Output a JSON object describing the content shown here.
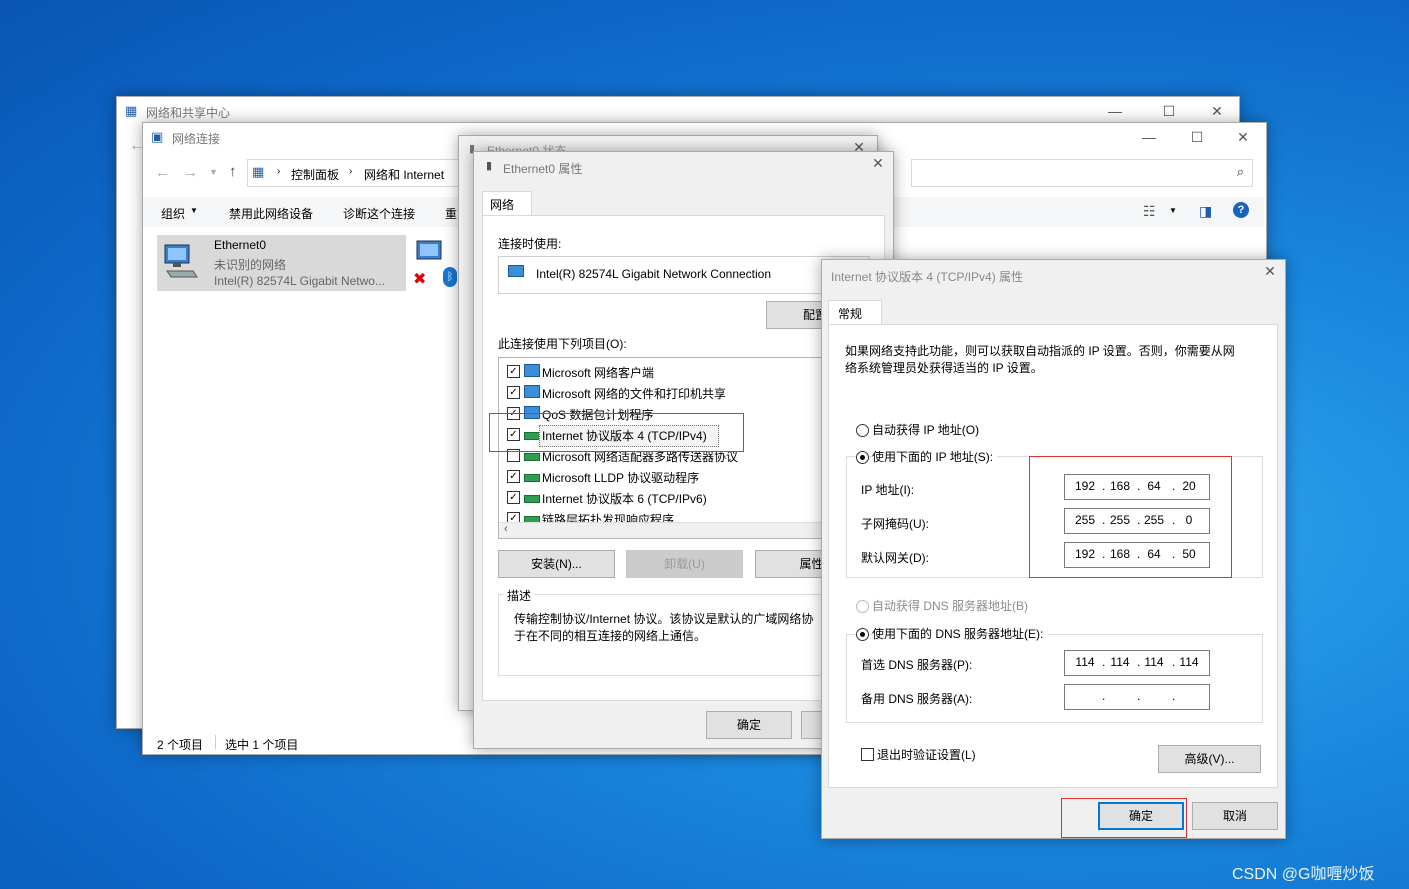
{
  "nsc_window": {
    "title": "网络和共享中心"
  },
  "nc_window": {
    "title": "网络连接",
    "breadcrumb": [
      "控制面板",
      "网络和 Internet"
    ],
    "toolbar": [
      "组织",
      "禁用此网络设备",
      "诊断这个连接",
      "重"
    ],
    "adapter": {
      "name": "Ethernet0",
      "status": "未识别的网络",
      "device": "Intel(R) 82574L Gigabit Netwo..."
    },
    "statusbar": {
      "count": "2 个项目",
      "selected": "选中 1 个项目"
    }
  },
  "status_window": {
    "title": "Ethernet0 状态"
  },
  "props_window": {
    "title": "Ethernet0 属性",
    "tab": "网络",
    "connect_using_label": "连接时使用:",
    "adapter_name": "Intel(R) 82574L Gigabit Network Connection",
    "configure_label": "配置(",
    "items_label": "此连接使用下列项目(O):",
    "items": [
      {
        "label": "Microsoft 网络客户端",
        "checked": true
      },
      {
        "label": "Microsoft 网络的文件和打印机共享",
        "checked": true
      },
      {
        "label": "QoS 数据包计划程序",
        "checked": true
      },
      {
        "label": "Internet 协议版本 4 (TCP/IPv4)",
        "checked": true
      },
      {
        "label": "Microsoft 网络适配器多路传送器协议",
        "checked": false
      },
      {
        "label": "Microsoft LLDP 协议驱动程序",
        "checked": true
      },
      {
        "label": "Internet 协议版本 6 (TCP/IPv6)",
        "checked": true
      },
      {
        "label": "链路层拓扑发现响应程序",
        "checked": true
      }
    ],
    "install_label": "安装(N)...",
    "uninstall_label": "卸载(U)",
    "properties_label": "属性(",
    "desc_title": "描述",
    "desc_text_1": "传输控制协议/Internet 协议。该协议是默认的广域网络协",
    "desc_text_2": "于在不同的相互连接的网络上通信。",
    "ok_label": "确定"
  },
  "ipv4_window": {
    "title": "Internet 协议版本 4 (TCP/IPv4) 属性",
    "tab": "常规",
    "intro_1": "如果网络支持此功能，则可以获取自动指派的 IP 设置。否则，你需要从网",
    "intro_2": "络系统管理员处获得适当的 IP 设置。",
    "auto_ip_label": "自动获得 IP 地址(O)",
    "manual_ip_label": "使用下面的 IP 地址(S):",
    "ip_label": "IP 地址(I):",
    "ip": [
      "192",
      "168",
      "64",
      "20"
    ],
    "mask_label": "子网掩码(U):",
    "mask": [
      "255",
      "255",
      "255",
      "0"
    ],
    "gateway_label": "默认网关(D):",
    "gateway": [
      "192",
      "168",
      "64",
      "50"
    ],
    "auto_dns_label": "自动获得 DNS 服务器地址(B)",
    "manual_dns_label": "使用下面的 DNS 服务器地址(E):",
    "dns1_label": "首选 DNS 服务器(P):",
    "dns1": [
      "114",
      "114",
      "114",
      "114"
    ],
    "dns2_label": "备用 DNS 服务器(A):",
    "dns2": [
      "",
      "",
      "",
      ""
    ],
    "validate_label": "退出时验证设置(L)",
    "advanced_label": "高级(V)...",
    "ok_label": "确定",
    "cancel_label": "取消"
  },
  "watermark": "CSDN @G咖喱炒饭"
}
